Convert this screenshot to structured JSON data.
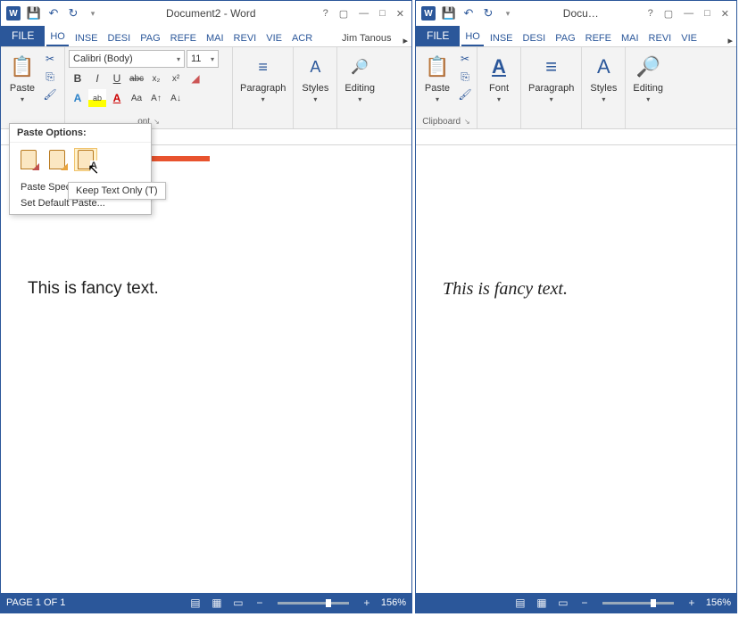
{
  "left": {
    "title": "Document2 - Word",
    "qat": {
      "save": "💾",
      "undo": "↶",
      "redo": "↻"
    },
    "user": "Jim Tanous",
    "tabs": {
      "file": "FILE",
      "list": [
        "HO",
        "INSE",
        "DESI",
        "PAG",
        "REFE",
        "MAI",
        "REVI",
        "VIE",
        "ACR"
      ],
      "more": "▸"
    },
    "ribbon": {
      "paste_label": "Paste",
      "font_group_label": "ont",
      "font_name": "Calibri (Body)",
      "font_size": "11",
      "bold": "B",
      "italic": "I",
      "underline": "U",
      "strike": "abc",
      "sub": "x₂",
      "sup": "x²",
      "paragraph_label": "Paragraph",
      "styles_label": "Styles",
      "editing_label": "Editing"
    },
    "paste_options": {
      "title": "Paste Options:",
      "menu_special": "Paste Special...",
      "menu_default": "Set Default Paste...",
      "tooltip": "Keep Text Only (T)"
    },
    "doc_text": "This is fancy text.",
    "status": {
      "page": "PAGE 1 OF 1",
      "zoom": "156%",
      "minus": "−",
      "plus": "+"
    }
  },
  "right": {
    "title": "Docu…",
    "tabs": {
      "file": "FILE",
      "list": [
        "HO",
        "INSE",
        "DESI",
        "PAG",
        "REFE",
        "MAI",
        "REVI",
        "VIE"
      ],
      "more": "▸"
    },
    "ribbon": {
      "paste_label": "Paste",
      "clipboard_label": "Clipboard",
      "font_label": "Font",
      "paragraph_label": "Paragraph",
      "styles_label": "Styles",
      "editing_label": "Editing"
    },
    "doc_text": "This is fancy text.",
    "status": {
      "zoom": "156%",
      "minus": "−",
      "plus": "+"
    }
  }
}
